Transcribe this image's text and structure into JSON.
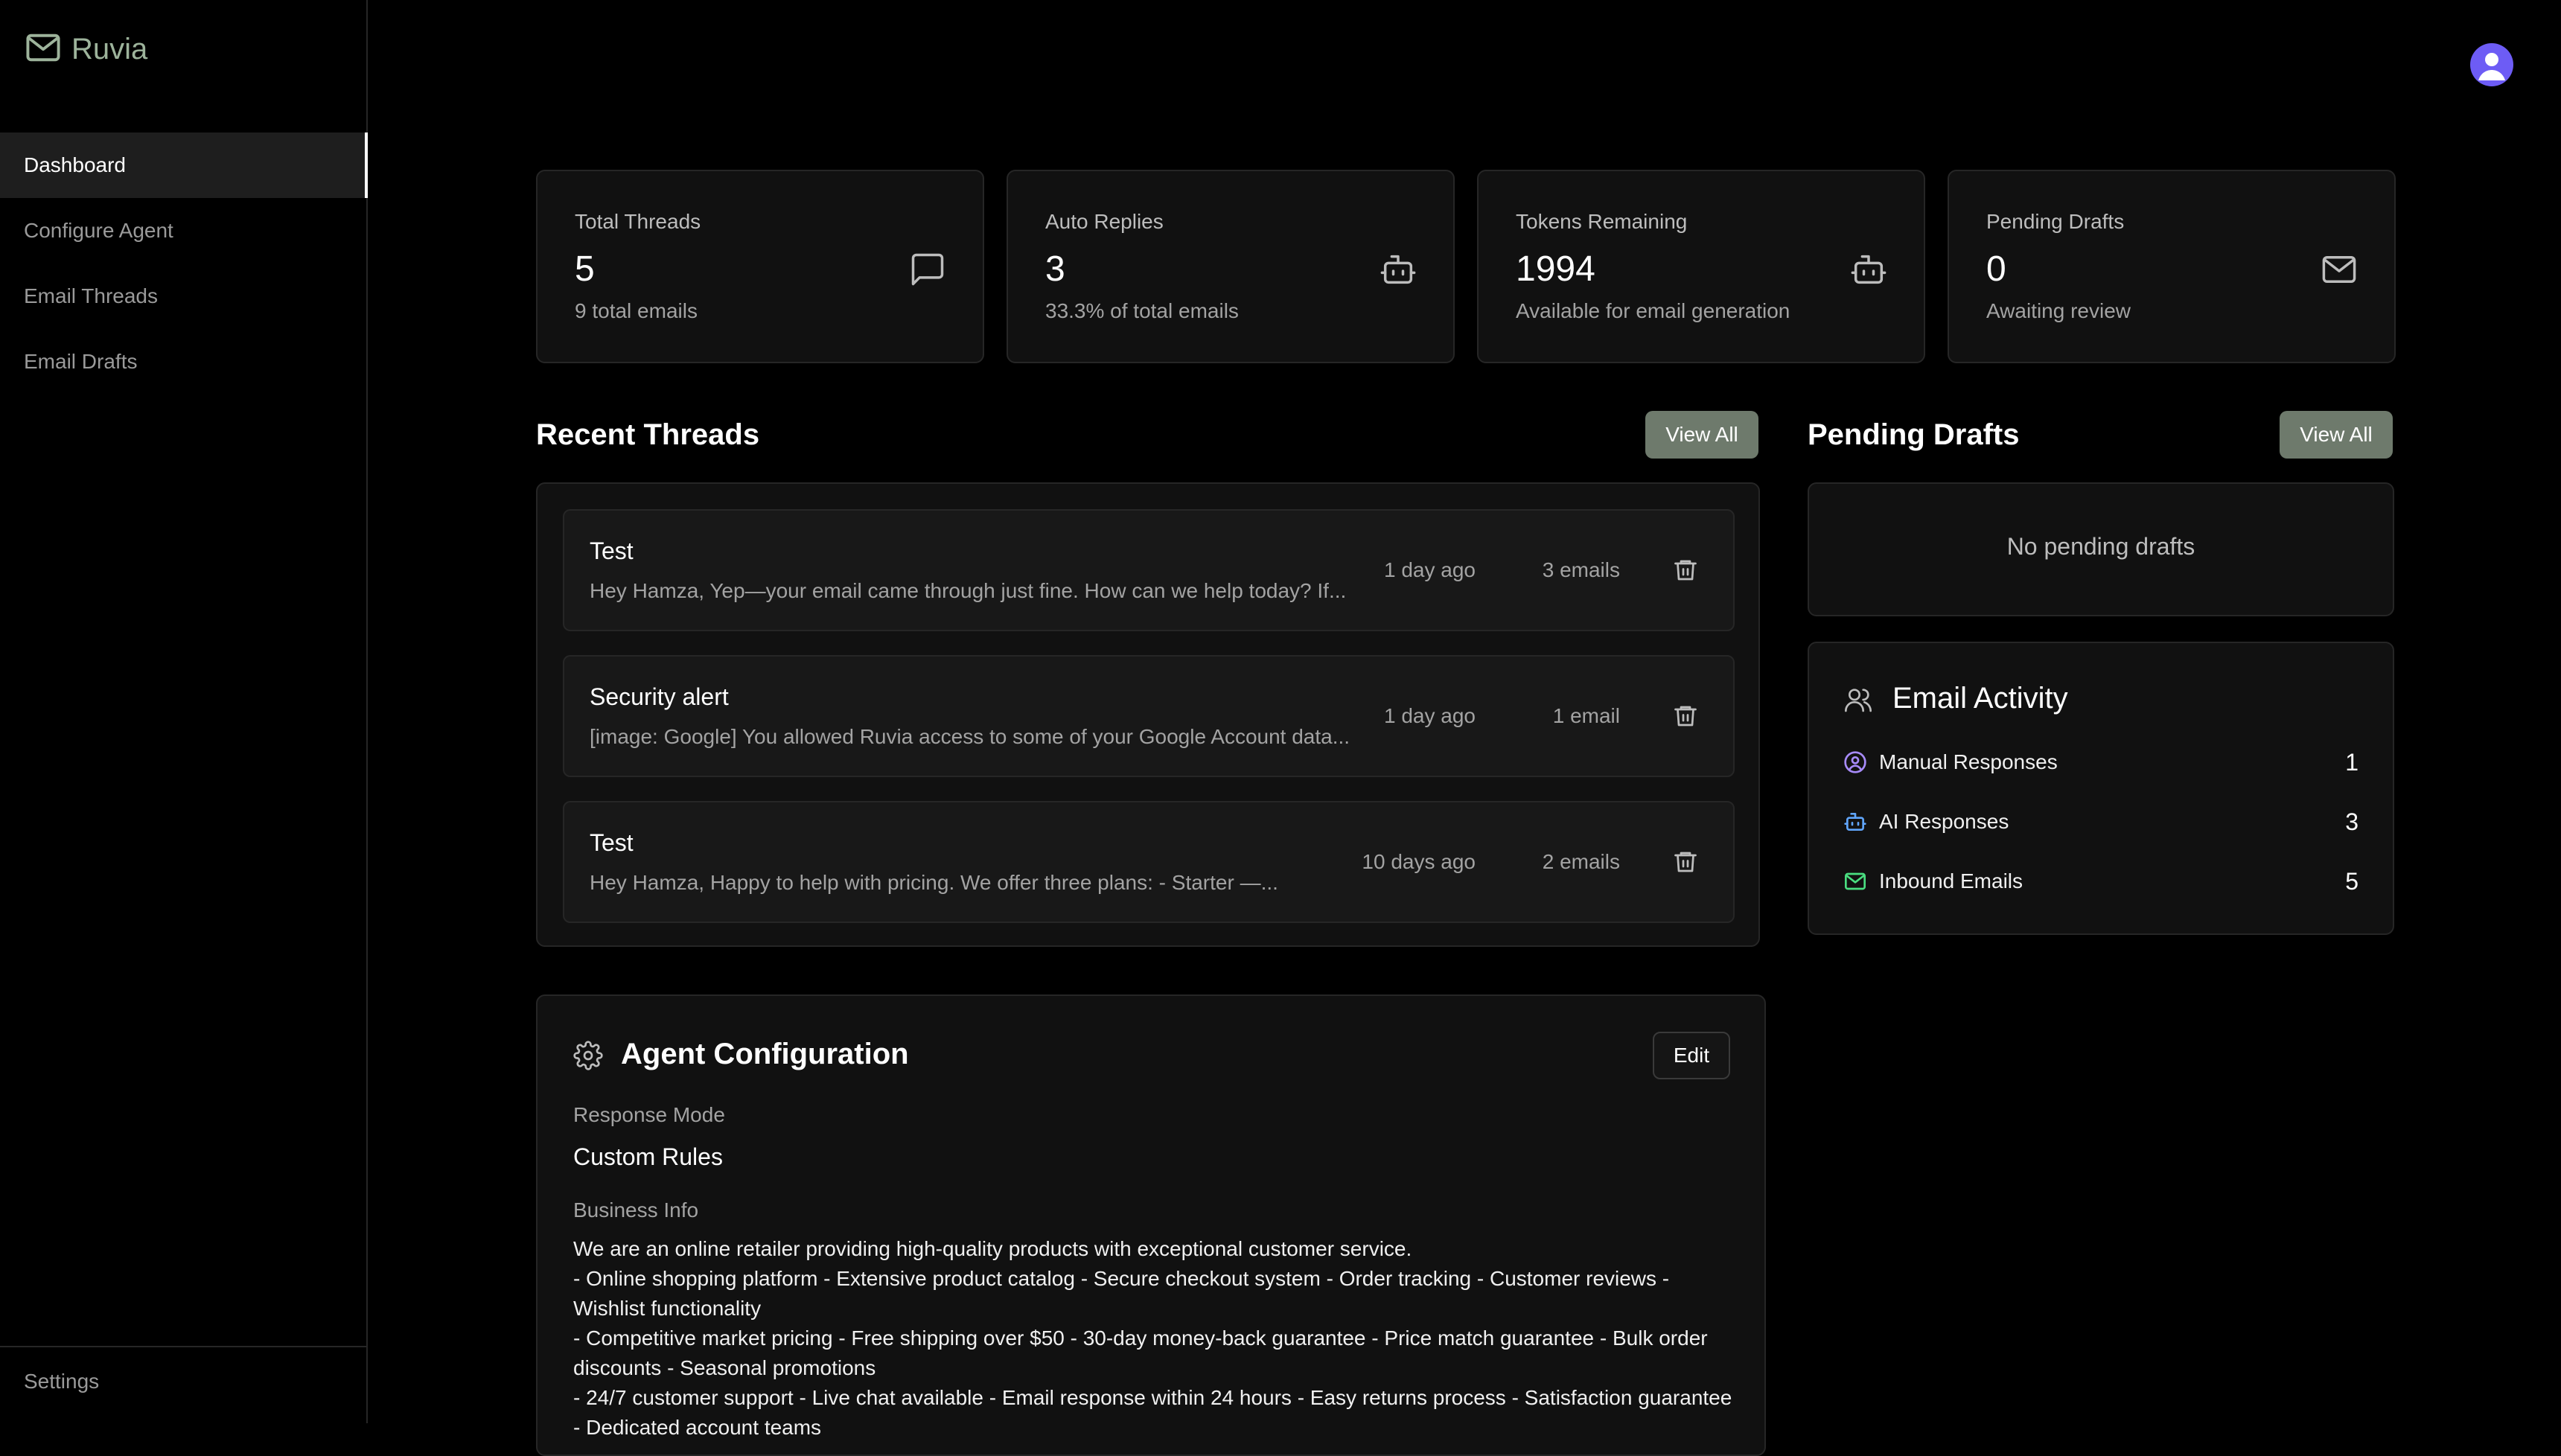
{
  "brand": {
    "name": "Ruvia"
  },
  "nav": {
    "items": [
      {
        "label": "Dashboard"
      },
      {
        "label": "Configure Agent"
      },
      {
        "label": "Email Threads"
      },
      {
        "label": "Email Drafts"
      }
    ],
    "settings": "Settings"
  },
  "stats": [
    {
      "title": "Total Threads",
      "value": "5",
      "sub": "9 total emails",
      "icon": "message-square-icon"
    },
    {
      "title": "Auto Replies",
      "value": "3",
      "sub": "33.3% of total emails",
      "icon": "bot-icon"
    },
    {
      "title": "Tokens Remaining",
      "value": "1994",
      "sub": "Available for email generation",
      "icon": "bot-icon"
    },
    {
      "title": "Pending Drafts",
      "value": "0",
      "sub": "Awaiting review",
      "icon": "mail-icon"
    }
  ],
  "recent_threads": {
    "title": "Recent Threads",
    "view_all": "View All",
    "items": [
      {
        "subject": "Test",
        "preview": "Hey Hamza, Yep—your email came through just fine. How can we help today? If...",
        "time": "1 day ago",
        "count": "3 emails"
      },
      {
        "subject": "Security alert",
        "preview": "[image: Google] You allowed Ruvia access to some of your Google Account data...",
        "time": "1 day ago",
        "count": "1 email"
      },
      {
        "subject": "Test",
        "preview": "Hey Hamza, Happy to help with pricing. We offer three plans: - Starter —...",
        "time": "10 days ago",
        "count": "2 emails"
      }
    ]
  },
  "pending_drafts": {
    "title": "Pending Drafts",
    "view_all": "View All",
    "empty": "No pending drafts"
  },
  "email_activity": {
    "title": "Email Activity",
    "rows": [
      {
        "label": "Manual Responses",
        "value": "1",
        "color": "#a78bfa",
        "icon": "user-circle-icon"
      },
      {
        "label": "AI Responses",
        "value": "3",
        "color": "#60a5fa",
        "icon": "bot-icon"
      },
      {
        "label": "Inbound Emails",
        "value": "5",
        "color": "#4ade80",
        "icon": "mail-icon"
      }
    ]
  },
  "agent_config": {
    "title": "Agent Configuration",
    "edit": "Edit",
    "response_mode_label": "Response Mode",
    "response_mode": "Custom Rules",
    "business_info_label": "Business Info",
    "business_info_lines": [
      "We are an online retailer providing high-quality products with exceptional customer service.",
      "- Online shopping platform - Extensive product catalog - Secure checkout system - Order tracking - Customer reviews - Wishlist functionality",
      "- Competitive market pricing - Free shipping over $50 - 30-day money-back guarantee - Price match guarantee - Bulk order discounts - Seasonal promotions",
      "- 24/7 customer support - Live chat available - Email response within 24 hours - Easy returns process - Satisfaction guarantee - Dedicated account teams"
    ]
  },
  "colors": {
    "accent_button": "#6e7a6c",
    "brand": "#9db39b",
    "avatar": "#6d5cf5"
  }
}
